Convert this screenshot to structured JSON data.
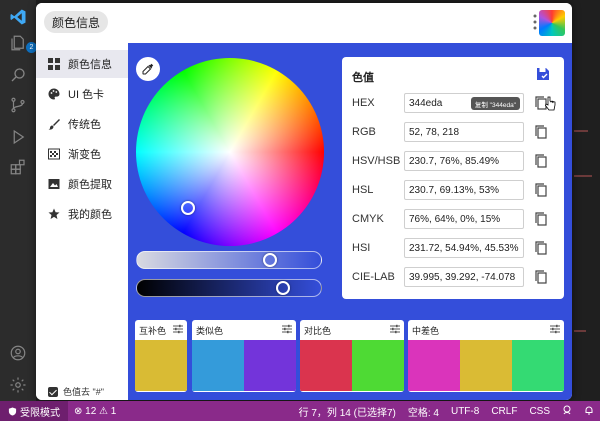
{
  "app": {
    "title": "颜色信息",
    "accent": "#344eda"
  },
  "activity_bar": {
    "badge": "2",
    "icons": [
      "vscode-logo-icon",
      "files-icon",
      "search-icon",
      "source-control-icon",
      "run-debug-icon",
      "extensions-icon",
      "account-icon",
      "settings-gear-icon"
    ]
  },
  "sidebar": {
    "items": [
      {
        "label": "颜色信息",
        "icon": "grid-icon",
        "active": true
      },
      {
        "label": "UI 色卡",
        "icon": "palette-icon",
        "active": false
      },
      {
        "label": "传统色",
        "icon": "brush-icon",
        "active": false
      },
      {
        "label": "渐变色",
        "icon": "gradient-icon",
        "active": false
      },
      {
        "label": "颜色提取",
        "icon": "image-icon",
        "active": false
      },
      {
        "label": "我的颜色",
        "icon": "star-icon",
        "active": false
      }
    ],
    "checkbox_label": "色值去 \"#\"",
    "checkbox_checked": true
  },
  "picker": {
    "wheel_handle": "white-ring",
    "saturation_level": 0.74,
    "value_level": 0.82
  },
  "values": {
    "title": "色值",
    "rows": [
      {
        "label": "HEX",
        "value": "344eda"
      },
      {
        "label": "RGB",
        "value": "52, 78, 218"
      },
      {
        "label": "HSV/HSB",
        "value": "230.7, 76%, 85.49%"
      },
      {
        "label": "HSL",
        "value": "230.7, 69.13%, 53%"
      },
      {
        "label": "CMYK",
        "value": "76%, 64%, 0%, 15%"
      },
      {
        "label": "HSI",
        "value": "231.72, 54.94%, 45.53%"
      },
      {
        "label": "CIE-LAB",
        "value": "39.995, 39.292, -74.078"
      }
    ],
    "tooltip": "复制 \"344eda\""
  },
  "palettes": [
    {
      "label": "互补色",
      "colors": [
        "#d9bb34"
      ]
    },
    {
      "label": "类似色",
      "colors": [
        "#349bda",
        "#7334da"
      ]
    },
    {
      "label": "对比色",
      "colors": [
        "#da344e",
        "#4eda34"
      ]
    },
    {
      "label": "中差色",
      "colors": [
        "#da34bb",
        "#dabb34",
        "#34da73"
      ]
    }
  ],
  "status_bar": {
    "restricted": "受限模式",
    "problems": "⊗ 12 ⚠ 1",
    "position": "行 7，列 14 (已选择7)",
    "indent": "空格: 4",
    "encoding": "UTF-8",
    "eol": "CRLF",
    "language": "CSS"
  }
}
